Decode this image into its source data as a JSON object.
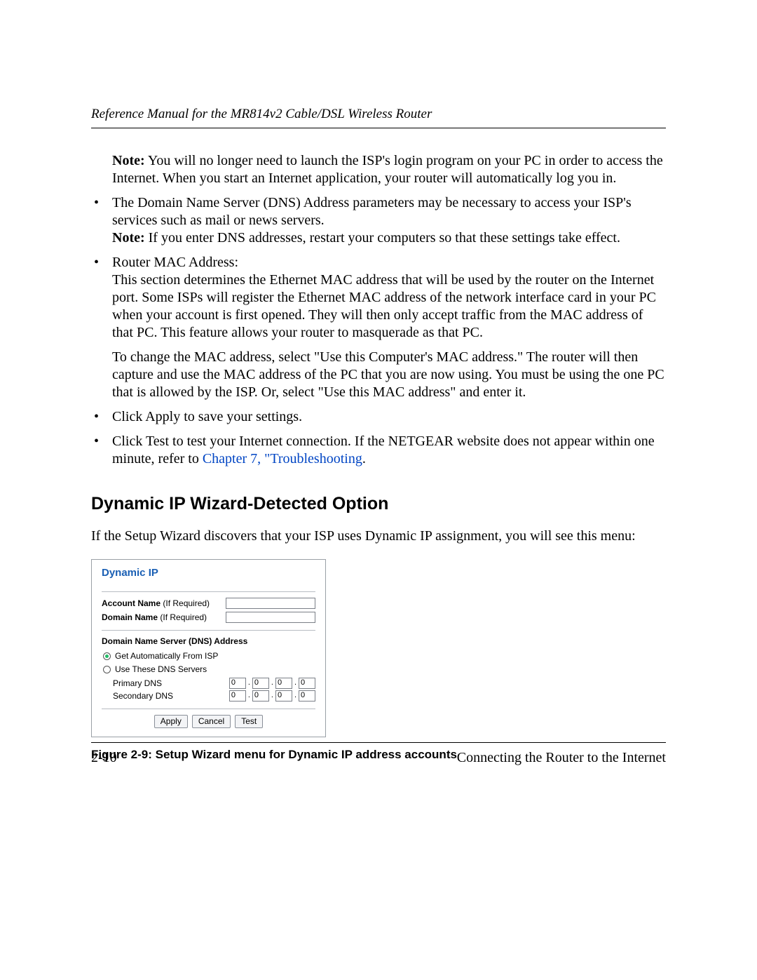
{
  "header": {
    "running_head": "Reference Manual for the MR814v2 Cable/DSL Wireless Router"
  },
  "body": {
    "note_label": "Note:",
    "note1_text": " You will no longer need to launch the ISP's login program on your PC in order to access the Internet. When you start an Internet application, your router will automatically log you in.",
    "bullet_dns_1": "The Domain Name Server (DNS) Address parameters may be necessary to access your ISP's services such as mail or news servers.",
    "bullet_dns_note": " If you enter DNS addresses, restart your computers so that these settings take effect.",
    "bullet_mac_title": "Router MAC Address:",
    "bullet_mac_p1": "This section determines the Ethernet MAC address that will be used by the router on the Internet port. Some ISPs will register the Ethernet MAC address of the network interface card in your PC when your account is first opened. They will then only accept traffic from the MAC address of that PC. This feature allows your router to masquerade as that PC.",
    "bullet_mac_p2": "To change the MAC address, select \"Use this Computer's MAC address.\" The router will then capture and use the MAC address of the PC that you are now using. You must be using the one PC that is allowed by the ISP. Or, select \"Use this MAC address\" and enter it.",
    "bullet_apply": "Click Apply to save your settings.",
    "bullet_test_pre": "Click Test to test your Internet connection. If the NETGEAR website does not appear within one minute, refer to ",
    "bullet_test_xref": "Chapter 7, \"Troubleshooting",
    "bullet_test_post": "."
  },
  "section": {
    "heading": "Dynamic IP Wizard-Detected Option",
    "intro": "If the Setup Wizard discovers that your ISP uses Dynamic IP assignment, you will see this menu:"
  },
  "figure": {
    "title": "Dynamic IP",
    "account_name_label_b": "Account Name",
    "account_name_label_r": " (If Required)",
    "domain_name_label_b": "Domain Name",
    "domain_name_label_r": " (If Required)",
    "dns_section_label": "Domain Name Server (DNS) Address",
    "radio_auto": "Get Automatically From ISP",
    "radio_manual": "Use These DNS Servers",
    "primary_dns_label": "Primary DNS",
    "secondary_dns_label": "Secondary DNS",
    "primary_dns": [
      "0",
      "0",
      "0",
      "0"
    ],
    "secondary_dns": [
      "0",
      "0",
      "0",
      "0"
    ],
    "btn_apply": "Apply",
    "btn_cancel": "Cancel",
    "btn_test": "Test",
    "caption": "Figure 2-9:  Setup Wizard menu for Dynamic IP address accounts"
  },
  "footer": {
    "page_num": "2-10",
    "chapter": "Connecting the Router to the Internet"
  }
}
